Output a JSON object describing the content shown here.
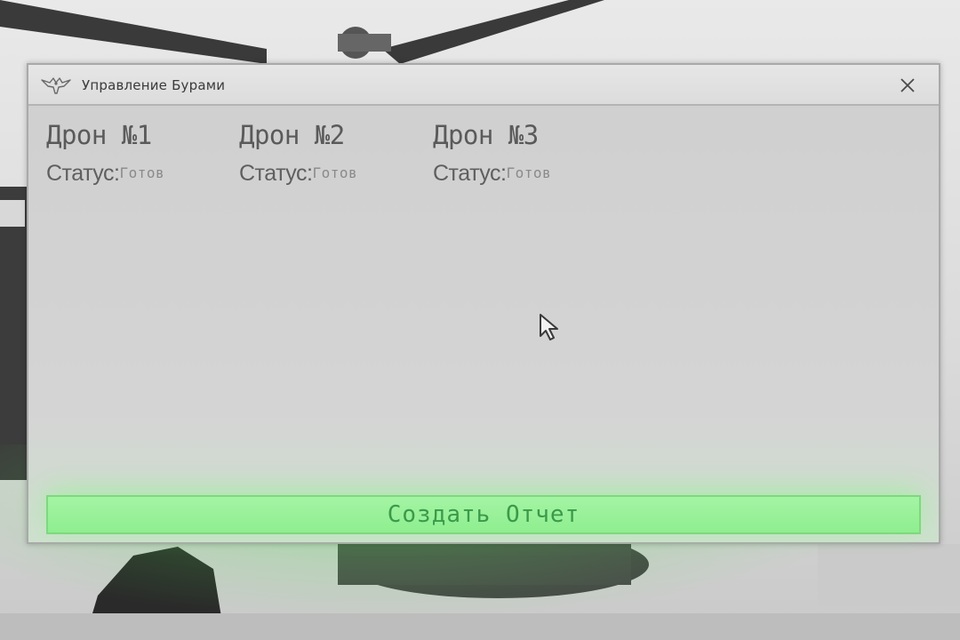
{
  "window": {
    "title": "Управление Бурами",
    "close_glyph": "✕"
  },
  "drones": [
    {
      "name": "Дрон №1",
      "status_label": "Статус:",
      "status_value": "Готов"
    },
    {
      "name": "Дрон №2",
      "status_label": "Статус:",
      "status_value": "Готов"
    },
    {
      "name": "Дрон №3",
      "status_label": "Статус:",
      "status_value": "Готов"
    }
  ],
  "actions": {
    "report_button": "Создать Отчет"
  },
  "icons": {
    "app": "eagle-icon",
    "close": "close-icon",
    "cursor": "mouse-cursor-icon"
  },
  "colors": {
    "button_bg": "#9af09a",
    "button_text": "#3a9a4a",
    "window_bg": "#d3d3d3"
  }
}
